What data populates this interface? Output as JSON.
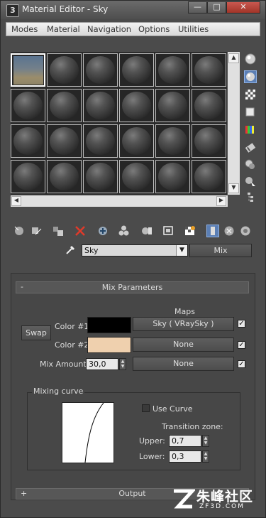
{
  "window": {
    "title": "Material Editor - Sky",
    "app_icon_glyph": "3"
  },
  "menu": [
    "Modes",
    "Material",
    "Navigation",
    "Options",
    "Utilities"
  ],
  "material": {
    "name": "Sky",
    "type_button": "Mix"
  },
  "rollout_mix": {
    "header": "Mix Parameters",
    "collapse_sign": "-",
    "maps_label": "Maps",
    "swap_label": "Swap",
    "color1_label": "Color #1",
    "color1_value": "#000000",
    "color2_label": "Color #2",
    "color2_value": "#efd0ae",
    "map1": "Sky  ( VRaySky )",
    "map2": "None",
    "mix_amount_label": "Mix Amount:",
    "mix_amount_value": "30,0",
    "mix_map": "None",
    "mixing_curve": {
      "group_label": "Mixing curve",
      "use_curve_label": "Use Curve",
      "use_curve_checked": false,
      "transition_label": "Transition zone:",
      "upper_label": "Upper:",
      "upper_value": "0,7",
      "lower_label": "Lower:",
      "lower_value": "0,3"
    }
  },
  "rollout_output": {
    "header": "Output",
    "expand_sign": "+"
  },
  "watermark": {
    "text": "朱峰社区",
    "sub": "ZF3D.COM"
  }
}
